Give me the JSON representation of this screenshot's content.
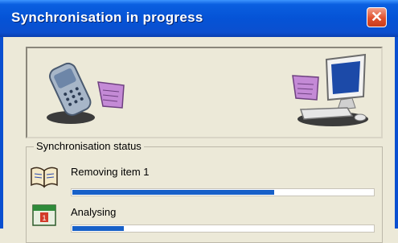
{
  "window": {
    "title": "Synchronisation in progress"
  },
  "status": {
    "group_label": "Synchronisation status",
    "rows": [
      {
        "label": "Removing item 1",
        "icon": "open-book-icon",
        "progress": 0.67
      },
      {
        "label": "Analysing",
        "icon": "calendar-icon",
        "progress": 0.17
      }
    ]
  },
  "colors": {
    "progress_fill": "#1760c8",
    "title_bar": "#0553d6",
    "close_button": "#e1512d"
  }
}
